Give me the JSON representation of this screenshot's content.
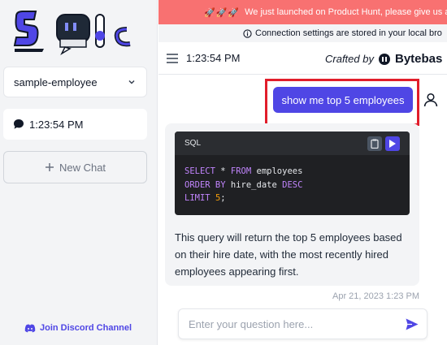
{
  "sidebar": {
    "logo_icon": "sqlchat-logo",
    "connection_select": {
      "value": "sample-employee",
      "icon": "chevron-down-icon"
    },
    "chat_items": [
      {
        "label": "1:23:54 PM",
        "icon": "chat-bubble-icon"
      }
    ],
    "new_chat_label": "New Chat",
    "discord_label": "Join Discord Channel"
  },
  "banner": {
    "emojis": "🚀🚀🚀",
    "text": "We just launched on Product Hunt, please give us a"
  },
  "info_bar": {
    "text": "Connection settings are stored in your local bro",
    "icon": "info-icon"
  },
  "header": {
    "title": "1:23:54 PM",
    "crafted_by": "Crafted by",
    "brand": "Bytebas"
  },
  "chat": {
    "user_message": "show me top 5 employees",
    "assistant": {
      "code_lang": "SQL",
      "code_lines": [
        [
          {
            "t": "SELECT",
            "c": "kw"
          },
          {
            "t": " * ",
            "c": ""
          },
          {
            "t": "FROM",
            "c": "kw"
          },
          {
            "t": " employees",
            "c": ""
          }
        ],
        [
          {
            "t": "ORDER BY",
            "c": "kw"
          },
          {
            "t": " hire_date ",
            "c": ""
          },
          {
            "t": "DESC",
            "c": "kw"
          }
        ],
        [
          {
            "t": "LIMIT",
            "c": "kw"
          },
          {
            "t": " ",
            "c": ""
          },
          {
            "t": "5",
            "c": "num"
          },
          {
            "t": ";",
            "c": ""
          }
        ]
      ],
      "answer": "This query will return the top 5 employees based on their hire date, with the most recently hired employees appearing first.",
      "timestamp": "Apr 21, 2023 1:23 PM"
    }
  },
  "input": {
    "placeholder": "Enter your question here...",
    "value": ""
  },
  "colors": {
    "accent": "#4f46e5",
    "banner": "#f87171",
    "highlight": "#e11d2b"
  }
}
